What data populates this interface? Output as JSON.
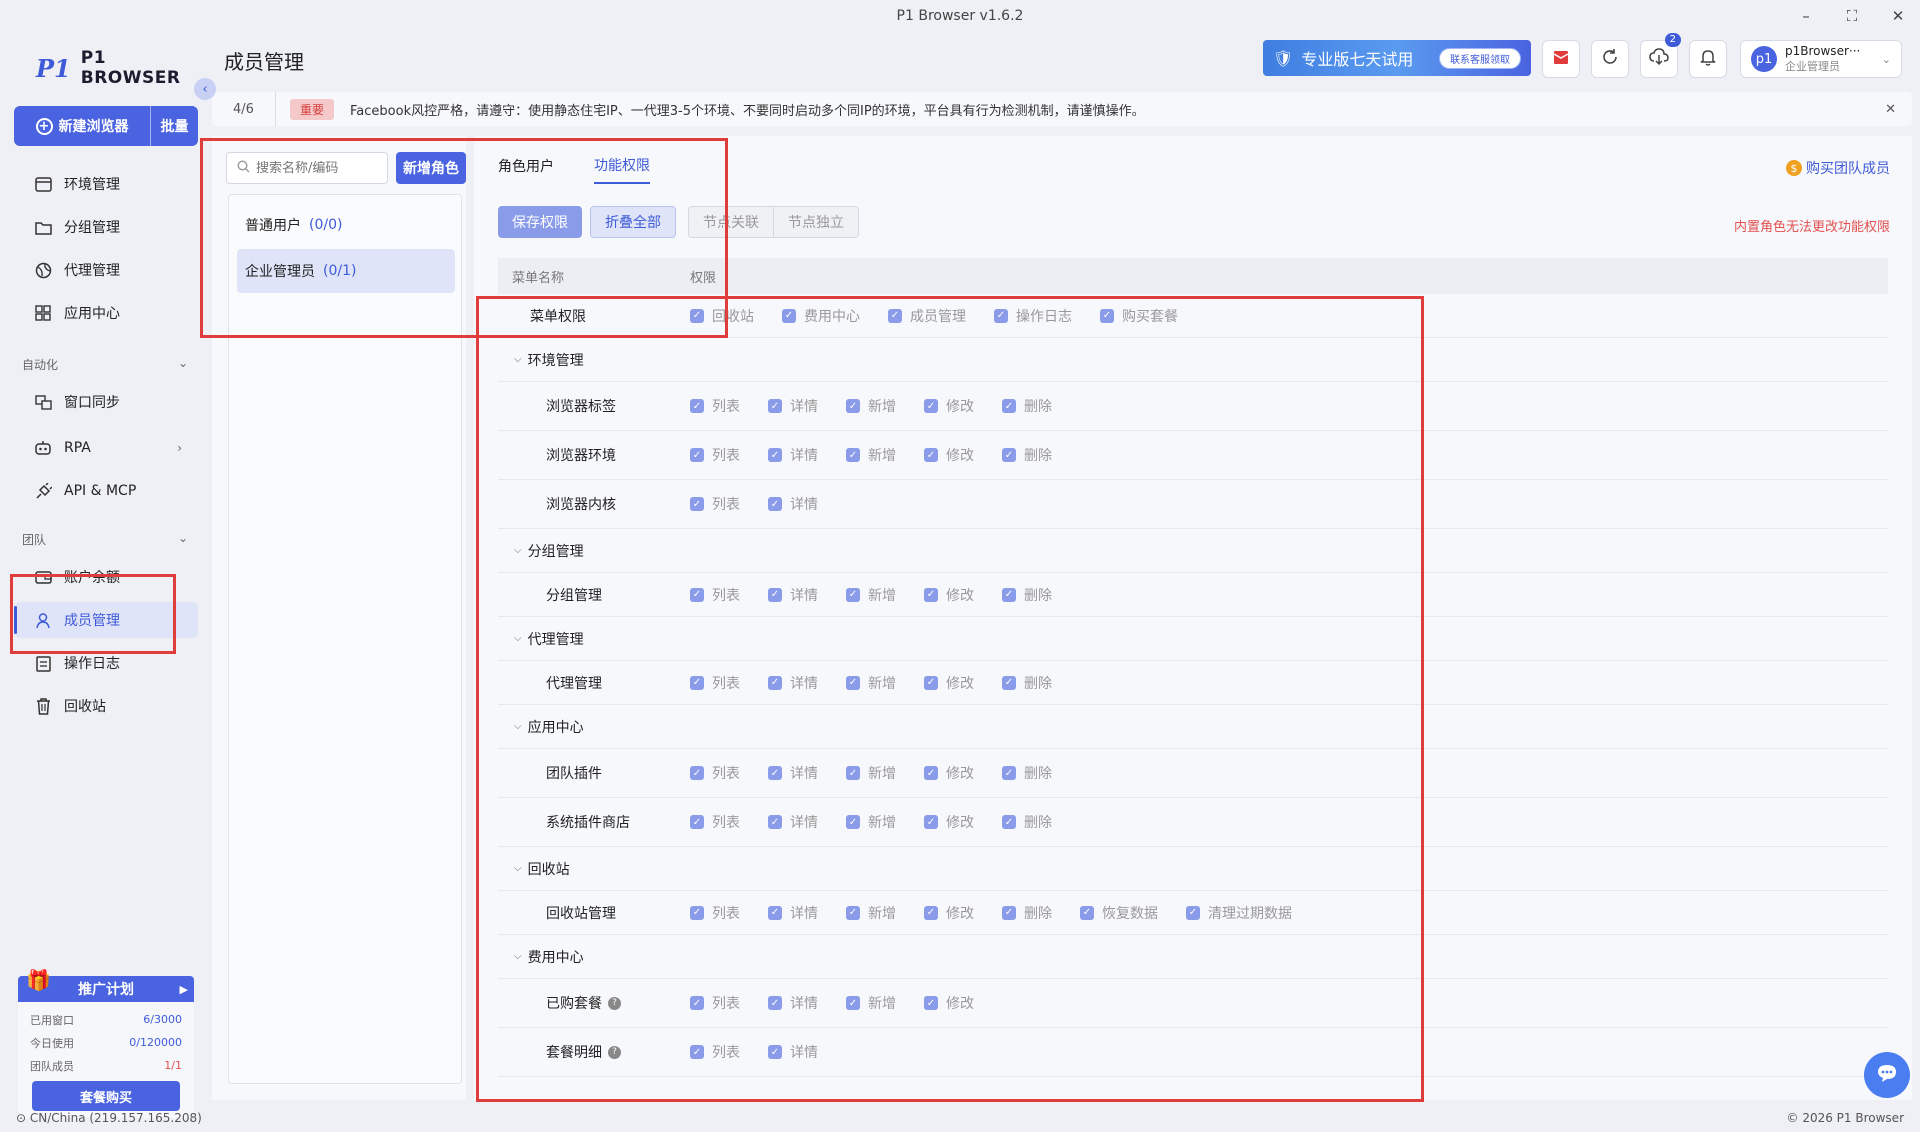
{
  "app": {
    "title": "P1 Browser v1.6.2",
    "logo_mark": "P1",
    "logo_text": "P1 BROWSER"
  },
  "window": {
    "minimize": "–",
    "maximize": "⛶",
    "close": "✕"
  },
  "sidebar": {
    "new_browser": "新建浏览器",
    "batch": "批量",
    "items_main": [
      {
        "label": "环境管理"
      },
      {
        "label": "分组管理"
      },
      {
        "label": "代理管理"
      },
      {
        "label": "应用中心"
      }
    ],
    "section_auto": "自动化",
    "items_auto": [
      {
        "label": "窗口同步"
      },
      {
        "label": "RPA"
      },
      {
        "label": "API & MCP"
      }
    ],
    "section_team": "团队",
    "items_team": [
      {
        "label": "账户余额"
      },
      {
        "label": "成员管理"
      },
      {
        "label": "操作日志"
      },
      {
        "label": "回收站"
      }
    ]
  },
  "promo": {
    "title": "推广计划",
    "rows": [
      {
        "label": "已用窗口",
        "value": "6/3000"
      },
      {
        "label": "今日使用",
        "value": "0/120000"
      },
      {
        "label": "团队成员",
        "value": "1/1"
      }
    ],
    "buy": "套餐购买"
  },
  "status": {
    "location": "CN/China (219.157.165.208)",
    "copyright": "© 2026 P1 Browser"
  },
  "header": {
    "title": "成员管理",
    "trial": "专业版七天试用",
    "trial_pill": "联系客服领取",
    "badge": "2",
    "user_name": "p1Browser···",
    "user_role": "企业管理员",
    "avatar": "p1"
  },
  "notice": {
    "count": "4/6",
    "tag": "重要",
    "text": "Facebook风控严格，请遵守：使用静态住宅IP、一代理3-5个环境、不要同时启动多个同IP的环境，平台具有行为检测机制，请谨慎操作。"
  },
  "roles": {
    "search_placeholder": "搜索名称/编码",
    "add": "新增角色",
    "items": [
      {
        "name": "普通用户",
        "count": "(0/0)"
      },
      {
        "name": "企业管理员",
        "count": "(0/1)"
      }
    ]
  },
  "main": {
    "tabs": [
      "角色用户",
      "功能权限"
    ],
    "buy_team": "购买团队成员",
    "save": "保存权限",
    "collapse": "折叠全部",
    "seg": [
      "节点关联",
      "节点独立"
    ],
    "warning": "内置角色无法更改功能权限",
    "col_name": "菜单名称",
    "col_perm": "权限"
  },
  "permissions": {
    "menu": {
      "name": "菜单权限",
      "perms": [
        "回收站",
        "费用中心",
        "成员管理",
        "操作日志",
        "购买套餐"
      ]
    },
    "env": {
      "name": "环境管理",
      "r1": {
        "name": "浏览器标签",
        "perms": [
          "列表",
          "详情",
          "新增",
          "修改",
          "删除"
        ]
      },
      "r2": {
        "name": "浏览器环境",
        "perms": [
          "列表",
          "详情",
          "新增",
          "修改",
          "删除"
        ]
      },
      "r3": {
        "name": "浏览器内核",
        "perms": [
          "列表",
          "详情"
        ]
      }
    },
    "group": {
      "name": "分组管理",
      "r1": {
        "name": "分组管理",
        "perms": [
          "列表",
          "详情",
          "新增",
          "修改",
          "删除"
        ]
      }
    },
    "proxy": {
      "name": "代理管理",
      "r1": {
        "name": "代理管理",
        "perms": [
          "列表",
          "详情",
          "新增",
          "修改",
          "删除"
        ]
      }
    },
    "app": {
      "name": "应用中心",
      "r1": {
        "name": "团队插件",
        "perms": [
          "列表",
          "详情",
          "新增",
          "修改",
          "删除"
        ]
      },
      "r2": {
        "name": "系统插件商店",
        "perms": [
          "列表",
          "详情",
          "新增",
          "修改",
          "删除"
        ]
      }
    },
    "recycle": {
      "name": "回收站",
      "r1": {
        "name": "回收站管理",
        "perms": [
          "列表",
          "详情",
          "新增",
          "修改",
          "删除",
          "恢复数据",
          "清理过期数据"
        ]
      }
    },
    "fee": {
      "name": "费用中心",
      "r1": {
        "name": "已购套餐",
        "perms": [
          "列表",
          "详情",
          "新增",
          "修改"
        ]
      },
      "r2": {
        "name": "套餐明细",
        "perms": [
          "列表",
          "详情"
        ]
      }
    }
  }
}
